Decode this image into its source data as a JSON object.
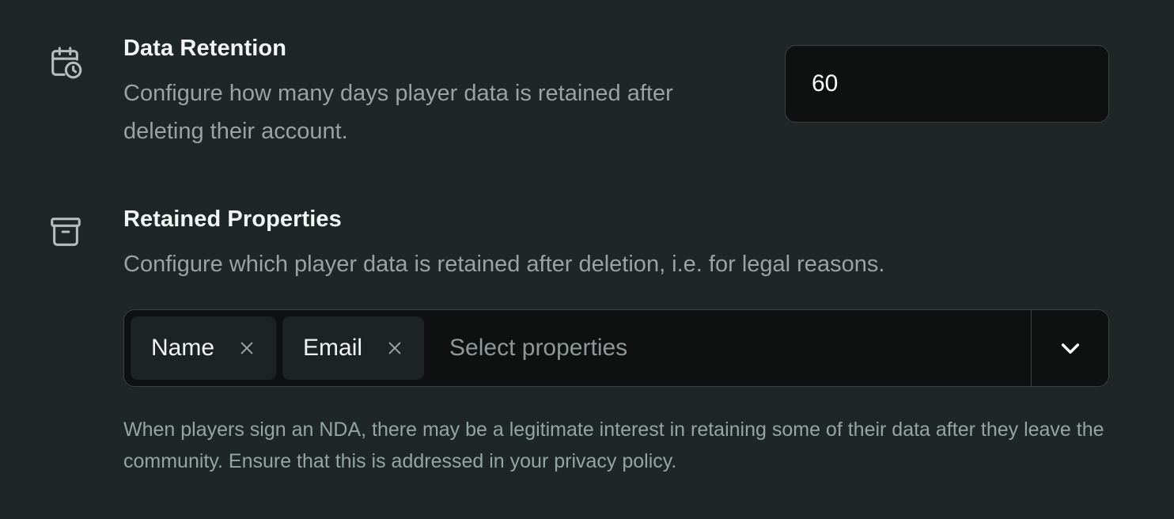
{
  "data_retention": {
    "icon": "calendar-clock-icon",
    "title": "Data Retention",
    "description": "Configure how many days player data is retained after deleting their account.",
    "days_value": "60"
  },
  "retained_properties": {
    "icon": "archive-icon",
    "title": "Retained Properties",
    "description": "Configure which player data is retained after deletion, i.e. for legal reasons.",
    "selected": [
      {
        "label": "Name"
      },
      {
        "label": "Email"
      }
    ],
    "placeholder": "Select properties",
    "helper_text": "When players sign an NDA, there may be a legitimate interest in retaining some of their data after they leave the community. Ensure that this is addressed in your privacy policy."
  },
  "colors": {
    "background": "#1f2626",
    "input_background": "#0f1111",
    "chip_background": "#1d2222",
    "muted_text": "#9aa3a1",
    "helper_text": "#93a6a0"
  }
}
